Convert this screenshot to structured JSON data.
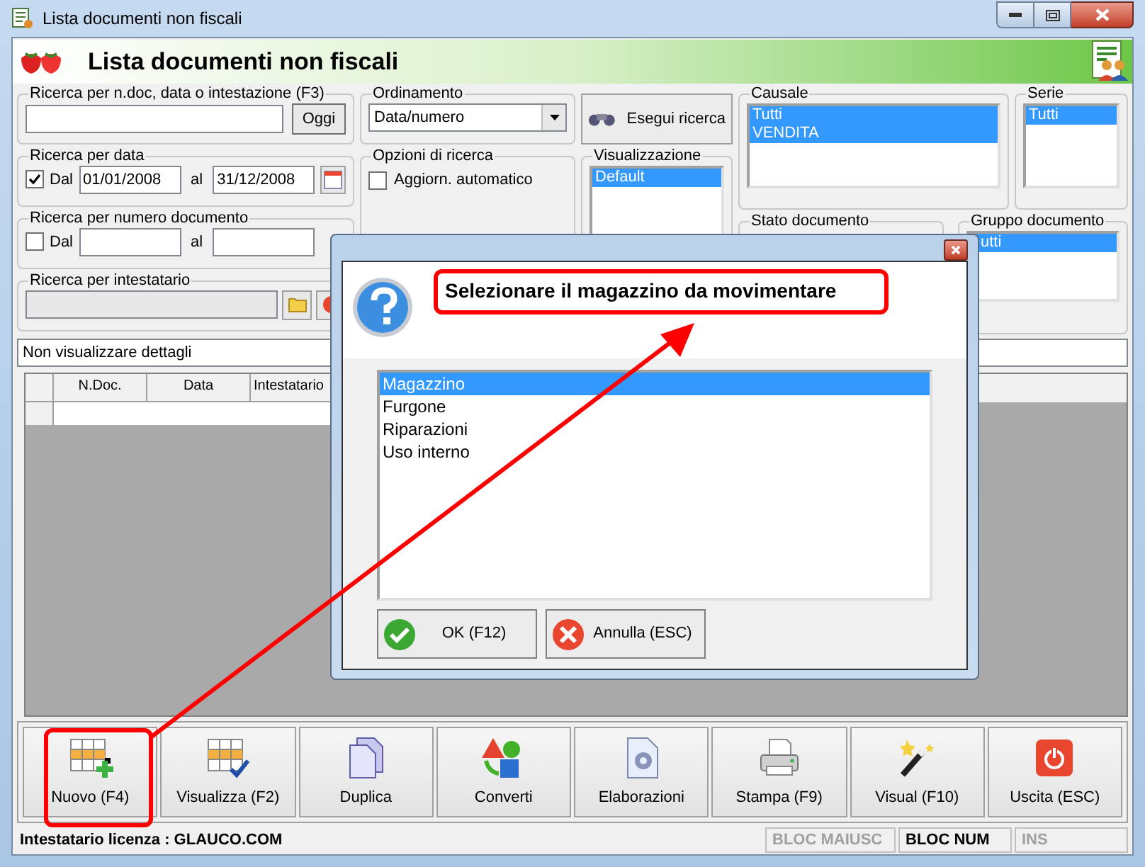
{
  "window": {
    "title": "Lista documenti non fiscali"
  },
  "header": {
    "title": "Lista documenti non fiscali"
  },
  "search_text": {
    "label": "Ricerca per n.doc, data o intestazione (F3)",
    "button": "Oggi"
  },
  "date_search": {
    "label": "Ricerca per data",
    "checked": true,
    "from_label": "Dal",
    "from": "01/01/2008",
    "to_label": "al",
    "to": "31/12/2008"
  },
  "number_search": {
    "label": "Ricerca per numero documento",
    "checked": false,
    "from_label": "Dal",
    "to_label": "al"
  },
  "holder_search": {
    "label": "Ricerca per intestatario"
  },
  "ordering": {
    "label": "Ordinamento",
    "value": "Data/numero"
  },
  "options": {
    "label": "Opzioni di ricerca",
    "auto_update": {
      "label": "Aggiorn. automatico",
      "checked": false
    }
  },
  "search_button": "Esegui ricerca",
  "view": {
    "label": "Visualizzazione",
    "items": [
      {
        "label": "Default",
        "selected": true
      }
    ]
  },
  "causale": {
    "label": "Causale",
    "items": [
      {
        "label": "Tutti",
        "selected": true
      },
      {
        "label": "VENDITA",
        "selected": true
      }
    ]
  },
  "serie": {
    "label": "Serie",
    "items": [
      {
        "label": "Tutti",
        "selected": true
      }
    ]
  },
  "state": {
    "label": "Stato documento"
  },
  "group": {
    "label": "Gruppo documento",
    "items": [
      {
        "label": "utti",
        "selected": true
      }
    ]
  },
  "details": {
    "value": "Non visualizzare dettagli"
  },
  "grid": {
    "columns": [
      "N.Doc.",
      "Data",
      "Intestatario"
    ]
  },
  "toolbar": [
    {
      "label": "Nuovo (F4)",
      "kind": "new"
    },
    {
      "label": "Visualizza (F2)",
      "kind": "view"
    },
    {
      "label": "Duplica",
      "kind": "duplicate"
    },
    {
      "label": "Converti",
      "kind": "convert"
    },
    {
      "label": "Elaborazioni",
      "kind": "process"
    },
    {
      "label": "Stampa (F9)",
      "kind": "print"
    },
    {
      "label": "Visual (F10)",
      "kind": "wand"
    },
    {
      "label": "Uscita (ESC)",
      "kind": "exit"
    }
  ],
  "status_bar": {
    "license": "Intestatario licenza : GLAUCO.COM",
    "indicators": [
      {
        "label": "BLOC MAIUSC",
        "on": false
      },
      {
        "label": "BLOC NUM",
        "on": true
      },
      {
        "label": "INS",
        "on": false
      }
    ]
  },
  "dialog": {
    "message": "Selezionare il magazzino da movimentare",
    "items": [
      {
        "label": "Magazzino",
        "selected": true
      },
      {
        "label": "Furgone",
        "selected": false
      },
      {
        "label": "Riparazioni",
        "selected": false
      },
      {
        "label": "Uso interno",
        "selected": false
      }
    ],
    "buttons": [
      {
        "label": "OK (F12)",
        "kind": "ok"
      },
      {
        "label": "Annulla (ESC)",
        "kind": "cancel"
      }
    ]
  }
}
